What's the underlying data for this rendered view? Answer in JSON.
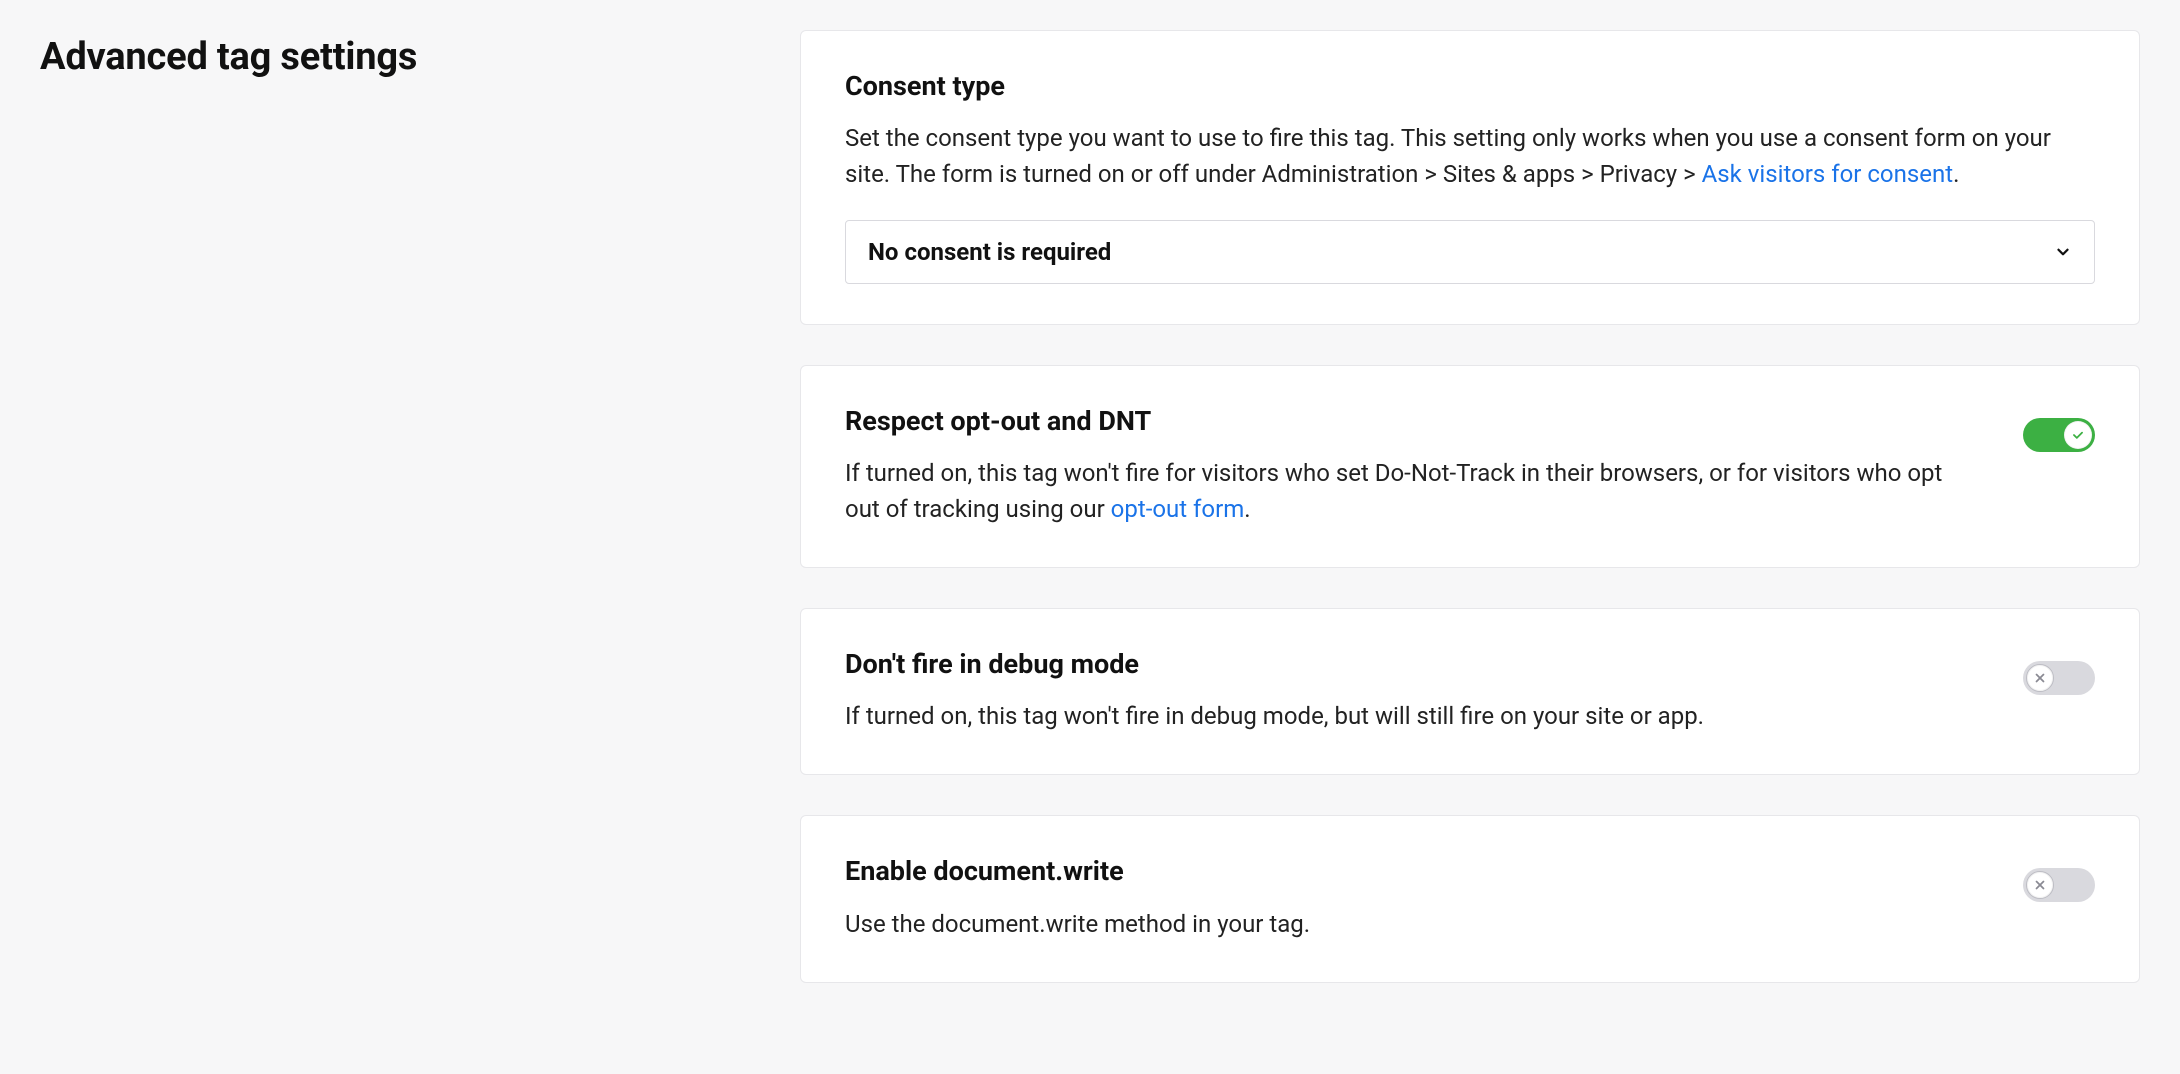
{
  "title": "Advanced tag settings",
  "cards": {
    "consent": {
      "title": "Consent type",
      "desc_before_link": "Set the consent type you want to use to fire this tag. This setting only works when you use a consent form on your site. The form is turned on or off under Administration > Sites & apps > Privacy > ",
      "link_text": "Ask visitors for consent",
      "desc_after_link": ".",
      "select_value": "No consent is required"
    },
    "respect": {
      "title": "Respect opt-out and DNT",
      "desc_before_link": "If turned on, this tag won't fire for visitors who set Do-Not-Track in their browsers, or for visitors who opt out of tracking using our ",
      "link_text": "opt-out form",
      "desc_after_link": ".",
      "toggle_on": true
    },
    "debug": {
      "title": "Don't fire in debug mode",
      "desc": "If turned on, this tag won't fire in debug mode, but will still fire on your site or app.",
      "toggle_on": false
    },
    "docwrite": {
      "title": "Enable document.write",
      "desc": "Use the document.write method in your tag.",
      "toggle_on": false
    }
  },
  "colors": {
    "link": "#1a73e8",
    "toggle_on_bg": "#3cb043",
    "toggle_off_bg": "#d9d9de"
  }
}
